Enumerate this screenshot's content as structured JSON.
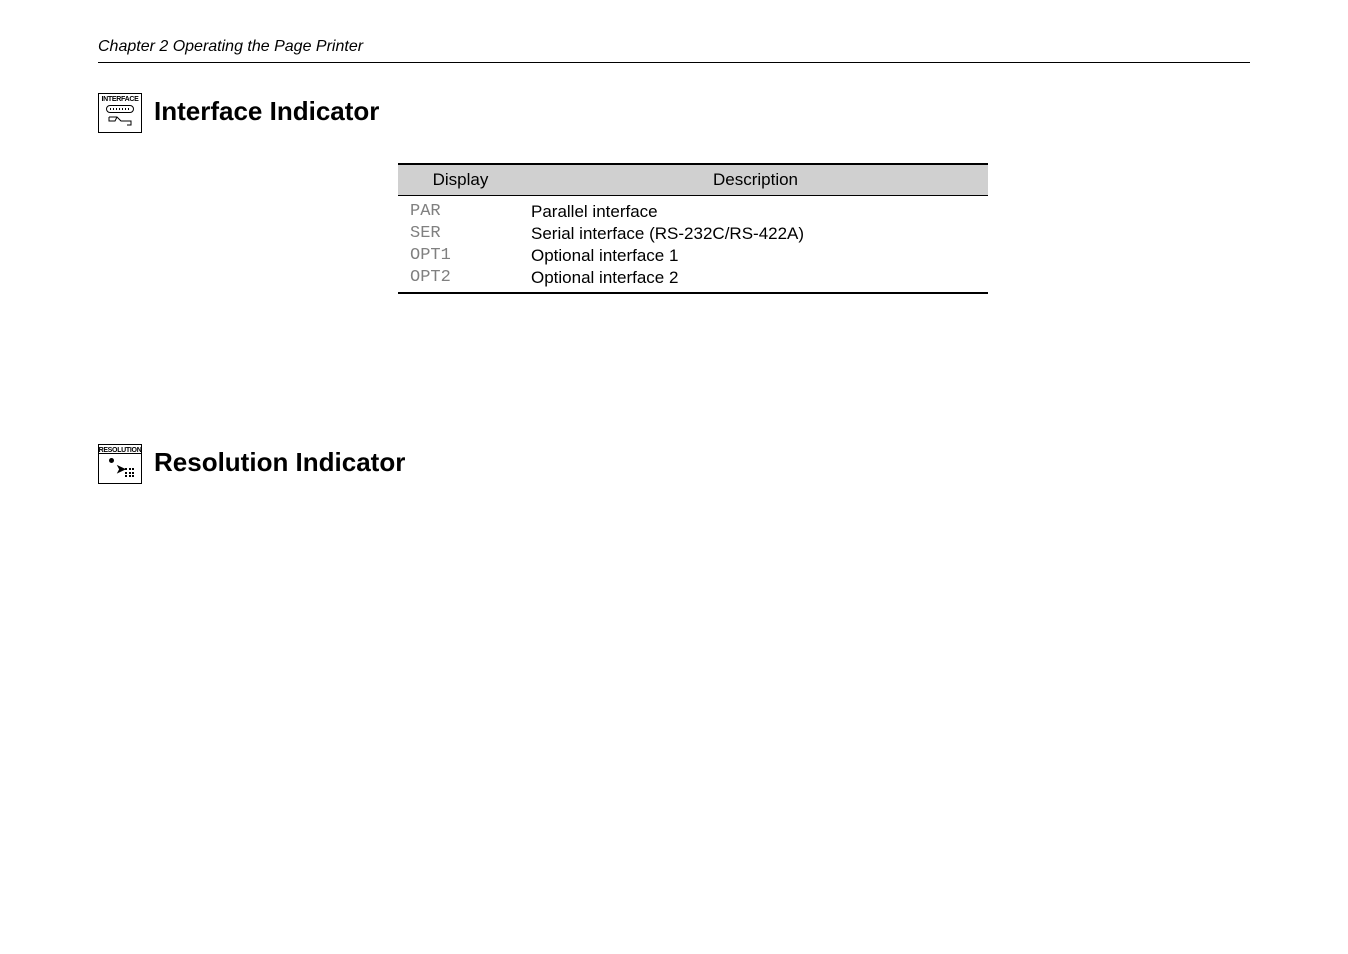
{
  "chapter_header": "Chapter 2  Operating the Page Printer",
  "interface_section": {
    "icon_label": "INTERFACE",
    "title": "Interface Indicator",
    "table": {
      "headers": {
        "display": "Display",
        "description": "Description"
      },
      "rows": [
        {
          "display": "PAR",
          "description": "Parallel interface"
        },
        {
          "display": "SER",
          "description": "Serial interface (RS-232C/RS-422A)"
        },
        {
          "display": "OPT1",
          "description": "Optional interface 1"
        },
        {
          "display": "OPT2",
          "description": "Optional interface 2"
        }
      ]
    }
  },
  "resolution_section": {
    "icon_label": "RESOLUTION",
    "title": "Resolution Indicator"
  }
}
